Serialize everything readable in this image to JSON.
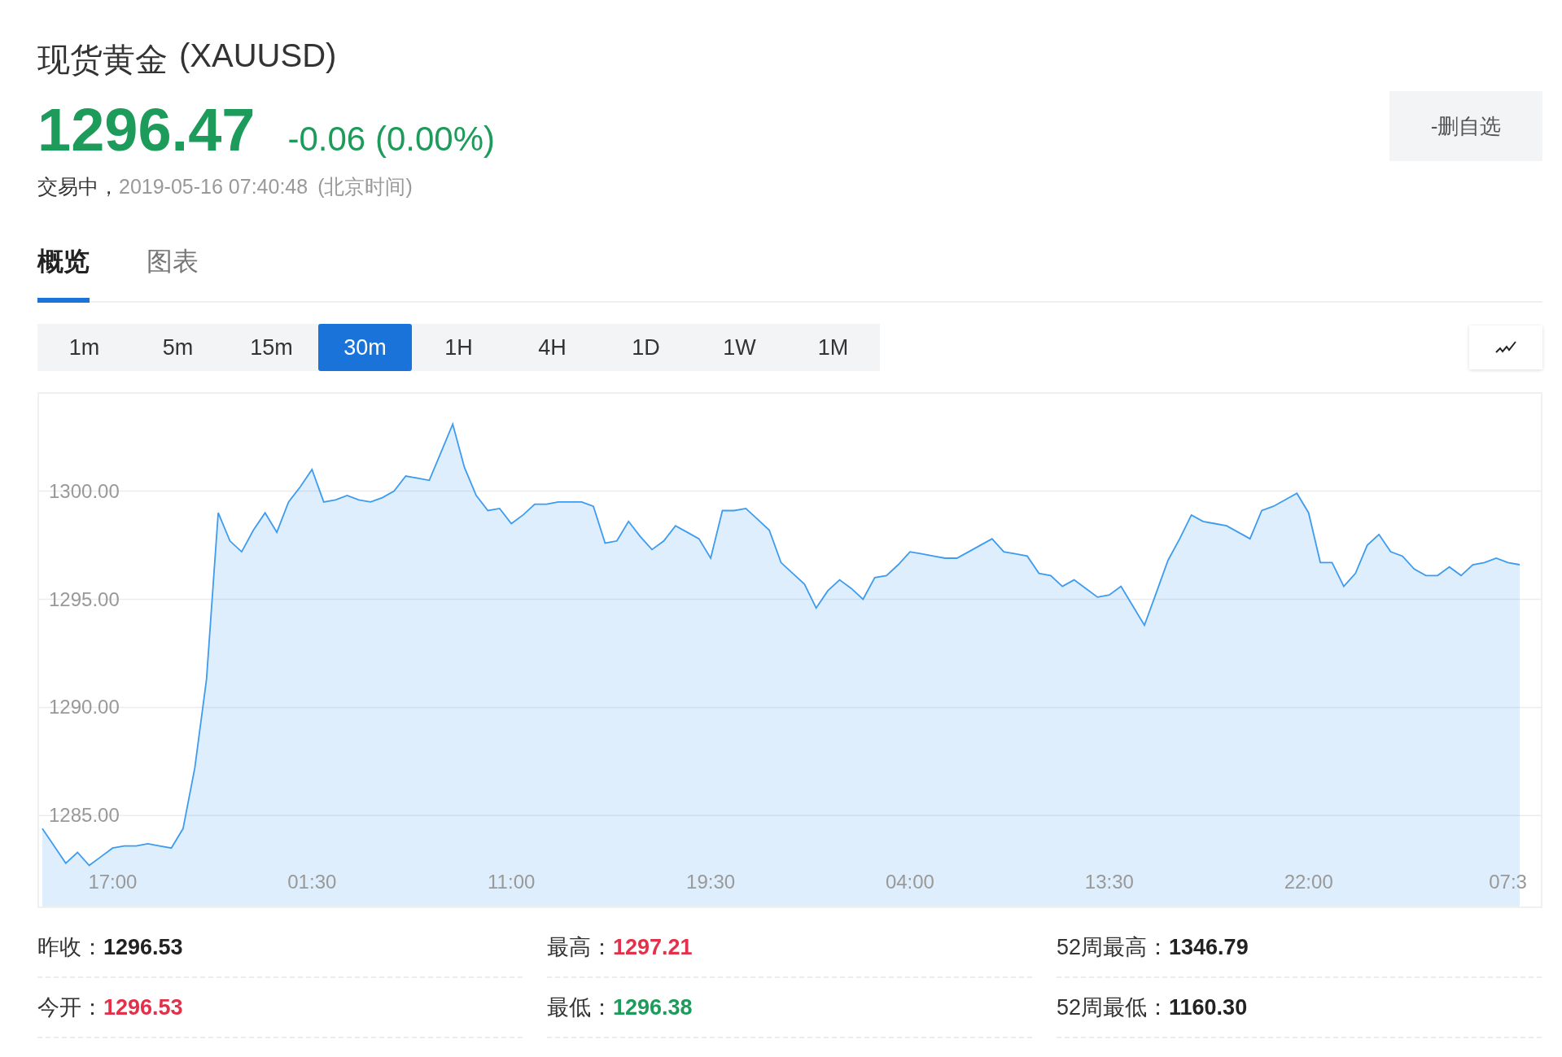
{
  "header": {
    "title": "现货黄金",
    "symbol": "(XAUUSD)",
    "price": "1296.47",
    "change": "-0.06 (0.00%)",
    "color": "#1d9b5a",
    "status": "交易中，",
    "timestamp": "2019-05-16 07:40:48",
    "timezone": "(北京时间)"
  },
  "watchlist_button": {
    "label": "-删自选"
  },
  "tabs": [
    {
      "label": "概览",
      "selected": true
    },
    {
      "label": "图表",
      "selected": false
    }
  ],
  "periods": [
    {
      "label": "1m",
      "selected": false
    },
    {
      "label": "5m",
      "selected": false
    },
    {
      "label": "15m",
      "selected": false
    },
    {
      "label": "30m",
      "selected": true
    },
    {
      "label": "1H",
      "selected": false
    },
    {
      "label": "4H",
      "selected": false
    },
    {
      "label": "1D",
      "selected": false
    },
    {
      "label": "1W",
      "selected": false
    },
    {
      "label": "1M",
      "selected": false
    }
  ],
  "chart": {
    "chart_data": {
      "type": "area",
      "categories": [
        null,
        null,
        null,
        null,
        null,
        null,
        "17:00",
        null,
        null,
        null,
        null,
        null,
        null,
        null,
        null,
        null,
        null,
        null,
        null,
        null,
        null,
        null,
        null,
        "01:30",
        null,
        null,
        null,
        null,
        null,
        null,
        null,
        null,
        null,
        null,
        null,
        null,
        null,
        null,
        null,
        null,
        "11:00",
        null,
        null,
        null,
        null,
        null,
        null,
        null,
        null,
        null,
        null,
        null,
        null,
        null,
        null,
        null,
        null,
        "19:30",
        null,
        null,
        null,
        null,
        null,
        null,
        null,
        null,
        null,
        null,
        null,
        null,
        null,
        null,
        null,
        null,
        "04:00",
        null,
        null,
        null,
        null,
        null,
        null,
        null,
        null,
        null,
        null,
        null,
        null,
        null,
        null,
        null,
        null,
        "13:30",
        null,
        null,
        null,
        null,
        null,
        null,
        null,
        null,
        null,
        null,
        null,
        null,
        null,
        null,
        null,
        null,
        "22:00",
        null,
        null,
        null,
        null,
        null,
        null,
        null,
        null,
        null,
        null,
        null,
        null,
        null,
        null,
        null,
        null,
        "07:3",
        null
      ],
      "grid": true,
      "series": [
        {
          "color": "#3d9bf0",
          "values": [
            1284.4,
            1283.6,
            1282.8,
            1283.3,
            1282.7,
            1283.1,
            1283.5,
            1283.6,
            1283.6,
            1283.7,
            1283.6,
            1283.5,
            1284.4,
            1287.2,
            1291.3,
            1299.0,
            1297.7,
            1297.2,
            1298.2,
            1299.0,
            1298.1,
            1299.5,
            1300.2,
            1301.0,
            1299.5,
            1299.6,
            1299.8,
            1299.6,
            1299.5,
            1299.7,
            1300.0,
            1300.7,
            1300.6,
            1300.5,
            1301.8,
            1303.1,
            1301.1,
            1299.8,
            1299.1,
            1299.2,
            1298.5,
            1298.9,
            1299.4,
            1299.4,
            1299.5,
            1299.5,
            1299.5,
            1299.3,
            1297.6,
            1297.7,
            1298.6,
            1297.9,
            1297.3,
            1297.7,
            1298.4,
            1298.1,
            1297.8,
            1296.9,
            1299.1,
            1299.1,
            1299.2,
            1298.7,
            1298.2,
            1296.7,
            1296.2,
            1295.7,
            1294.6,
            1295.4,
            1295.9,
            1295.5,
            1295.0,
            1296.0,
            1296.1,
            1296.6,
            1297.2,
            1297.1,
            1297.0,
            1296.9,
            1296.9,
            1297.2,
            1297.5,
            1297.8,
            1297.2,
            1297.1,
            1297.0,
            1296.2,
            1296.1,
            1295.6,
            1295.9,
            1295.5,
            1295.1,
            1295.2,
            1295.6,
            1294.7,
            1293.8,
            1295.3,
            1296.8,
            1297.8,
            1298.9,
            1298.6,
            1298.5,
            1298.4,
            1298.1,
            1297.8,
            1299.1,
            1299.3,
            1299.6,
            1299.9,
            1299.0,
            1296.7,
            1296.7,
            1295.6,
            1296.2,
            1297.5,
            1298.0,
            1297.2,
            1297.0,
            1296.4,
            1296.1,
            1296.1,
            1296.5,
            1296.1,
            1296.6,
            1296.7,
            1296.9,
            1296.7,
            1296.6
          ]
        }
      ],
      "ylim": [
        1280.8,
        1304.5
      ],
      "yticks": [
        {
          "value": 1285,
          "label": "1285.00"
        },
        {
          "value": 1290,
          "label": "1290.00"
        },
        {
          "value": 1295,
          "label": "1295.00"
        },
        {
          "value": 1300,
          "label": "1300.00"
        }
      ]
    }
  },
  "stats": [
    {
      "label": "昨收：",
      "value": "1296.53",
      "color": "#222222"
    },
    {
      "label": "最高：",
      "value": "1297.21",
      "color": "#e3304b"
    },
    {
      "label": "52周最高：",
      "value": "1346.79",
      "color": "#222222"
    },
    {
      "label": "今开：",
      "value": "1296.53",
      "color": "#e3304b"
    },
    {
      "label": "最低：",
      "value": "1296.38",
      "color": "#1d9b5a"
    },
    {
      "label": "52周最低：",
      "value": "1160.30",
      "color": "#222222"
    }
  ]
}
